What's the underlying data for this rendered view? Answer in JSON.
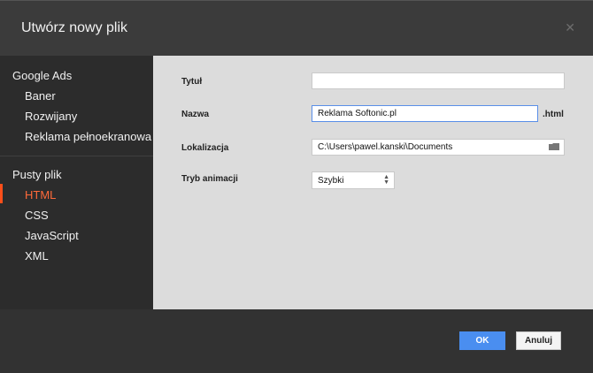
{
  "dialog": {
    "title": "Utwórz nowy plik",
    "close_icon": "close-icon"
  },
  "sidebar": {
    "groups": [
      {
        "title": "Google Ads",
        "items": [
          "Baner",
          "Rozwijany",
          "Reklama pełnoekranowa"
        ]
      },
      {
        "title": "Pusty plik",
        "items": [
          "HTML",
          "CSS",
          "JavaScript",
          "XML"
        ]
      }
    ],
    "active_item": "HTML",
    "accent_color": "#ff5a24"
  },
  "form": {
    "title_label": "Tytuł",
    "title_value": "",
    "name_label": "Nazwa",
    "name_value": "Reklama Softonic.pl",
    "name_suffix": ".html",
    "location_label": "Lokalizacja",
    "location_value": "C:\\Users\\pawel.kanski\\Documents",
    "folder_icon": "folder-icon",
    "animation_label": "Tryb animacji",
    "animation_value": "Szybki"
  },
  "footer": {
    "ok_label": "OK",
    "cancel_label": "Anuluj"
  }
}
